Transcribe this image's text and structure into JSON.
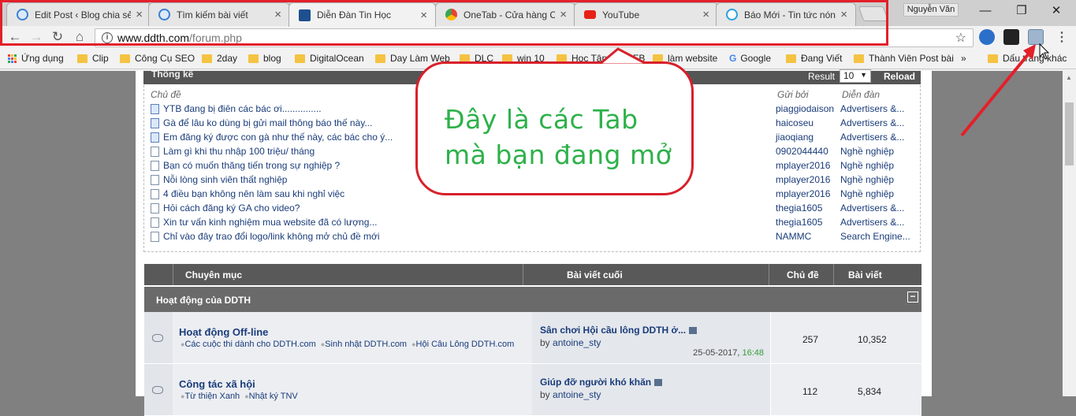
{
  "tabs": [
    {
      "title": "Edit Post ‹ Blog chia sẻ",
      "icon": "blog-favicon-icon",
      "color": "#3b7fd4"
    },
    {
      "title": "Tìm kiếm bài viết",
      "icon": "blog-favicon-icon",
      "color": "#3b7fd4"
    },
    {
      "title": "Diễn Đàn Tin Học",
      "icon": "ddth-favicon-icon",
      "color": "#1e4f8f"
    },
    {
      "title": "OneTab - Cửa hàng Ch",
      "icon": "chrome-store-icon",
      "color": "#e94235"
    },
    {
      "title": "YouTube",
      "icon": "youtube-icon",
      "color": "#e62117"
    },
    {
      "title": "Báo Mới - Tin tức nóng",
      "icon": "baomoi-favicon-icon",
      "color": "#2d9fe0"
    }
  ],
  "profile_name": "Nguyễn Văn",
  "address": {
    "host": "www.ddth.com",
    "path": "/forum.php"
  },
  "bookmarks": [
    "Ứng dụng",
    "Clip",
    "Công Cụ SEO",
    "2day",
    "blog",
    "DigitalOcean",
    "Day Làm Web",
    "DLC",
    "win 10",
    "Học Tập",
    "FB",
    "làm website",
    "Google",
    "Đang Viết",
    "Thành Viên Post bài",
    "Dấu trang khác"
  ],
  "callout": {
    "line1": "Đây là các Tab",
    "line2": "mà bạn đang mở"
  },
  "stats": {
    "title": "Thống kê",
    "result_label": "Result",
    "result_value": "10",
    "reload": "Reload",
    "col_topic": "Chủ đề",
    "col_by": "Gửi bởi",
    "col_forum": "Diễn đàn",
    "rows": [
      {
        "t": "YTB đang bị điên các bác ơi...............",
        "by": "piaggiodaison",
        "f": "Advertisers &..."
      },
      {
        "t": "Gà để lâu ko dùng bị gửi mail thông báo thế này...",
        "by": "haicoseu",
        "f": "Advertisers &..."
      },
      {
        "t": "Em đăng ký được con gà như thế này, các bác cho ý...",
        "by": "jiaoqiang",
        "f": "Advertisers &..."
      },
      {
        "t": "Làm gì khi thu nhập 100 triệu/ tháng",
        "by": "0902044440",
        "f": "Nghề nghiệp"
      },
      {
        "t": "Bạn có muốn thăng tiến trong sự nghiệp ?",
        "by": "mplayer2016",
        "f": "Nghề nghiệp"
      },
      {
        "t": "Nỗi lòng sinh viên thất nghiệp",
        "by": "mplayer2016",
        "f": "Nghề nghiệp"
      },
      {
        "t": "4 điều bạn không nên làm sau khi nghỉ việc",
        "by": "mplayer2016",
        "f": "Nghề nghiệp"
      },
      {
        "t": "Hỏi cách đăng ký GA cho video?",
        "by": "thegia1605",
        "f": "Advertisers &..."
      },
      {
        "t": "Xin tư vấn kinh nghiệm mua website đã có lượng...",
        "by": "thegia1605",
        "f": "Advertisers &..."
      },
      {
        "t": "Chỉ vào đây trao đổi logo/link không mở chủ đề mới",
        "by": "NAMMC",
        "f": "Search Engine..."
      }
    ]
  },
  "forum": {
    "col_category": "Chuyên mục",
    "col_last": "Bài viết cuối",
    "col_threads": "Chủ đề",
    "col_posts": "Bài viết",
    "category": "Hoạt động của DDTH",
    "rows": [
      {
        "name": "Hoạt động Off-line",
        "subs": [
          "Các cuộc thi dành cho DDTH.com",
          "Sinh nhật DDTH.com",
          "Hội Câu Lông DDTH.com"
        ],
        "last_title": "Sân chơi Hội cầu lông DDTH ở...",
        "last_by_prefix": "by",
        "last_by": "antoine_sty",
        "date": "25-05-2017,",
        "time": "16:48",
        "threads": "257",
        "posts": "10,352"
      },
      {
        "name": "Công tác xã hội",
        "subs": [
          "Từ thiện Xanh",
          "Nhật ký TNV"
        ],
        "last_title": "Giúp đỡ người khó khăn",
        "last_by_prefix": "by",
        "last_by": "antoine_sty",
        "date": "",
        "time": "",
        "threads": "112",
        "posts": "5,834"
      }
    ]
  }
}
